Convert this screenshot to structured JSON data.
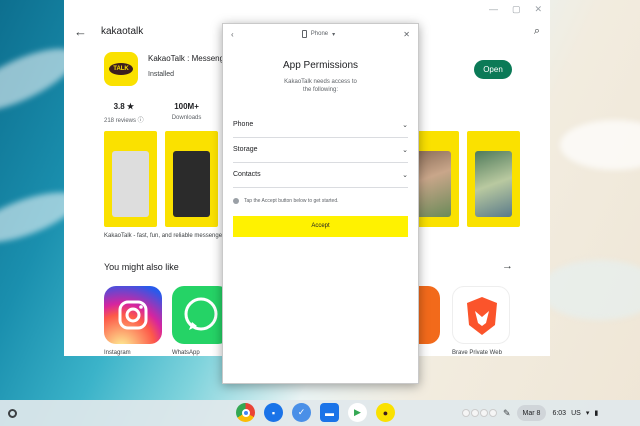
{
  "store": {
    "search_text": "kakaotalk",
    "app_name": "KakaoTalk : Messenger",
    "app_status": "Installed",
    "open_label": "Open",
    "rating": "3.8 ★",
    "reviews": "218 reviews ⓘ",
    "downloads_value": "100M+",
    "downloads_label": "Downloads",
    "description": "KakaoTalk - fast, fun, and reliable messenger",
    "might_like": "You might also like",
    "recommendations": [
      "Instagram",
      "WhatsApp",
      "Brave Private Web"
    ],
    "logo_text": "TALK"
  },
  "dialog": {
    "device": "Phone",
    "title": "App Permissions",
    "subtitle": "KakaoTalk needs access to the following:",
    "permissions": [
      "Phone",
      "Storage",
      "Contacts"
    ],
    "tip": "Tap the Accept button below to get started.",
    "accept_label": "Accept"
  },
  "shelf": {
    "date": "Mar 8",
    "time": "6:03",
    "locale": "US",
    "dock_apps": [
      "chrome-icon",
      "chat-icon",
      "app-icon",
      "files-icon",
      "play-store-icon",
      "kakaotalk-icon"
    ]
  },
  "colors": {
    "kakao_yellow": "#fae100",
    "accept_yellow": "#fff200",
    "open_green": "#0b7a57"
  }
}
